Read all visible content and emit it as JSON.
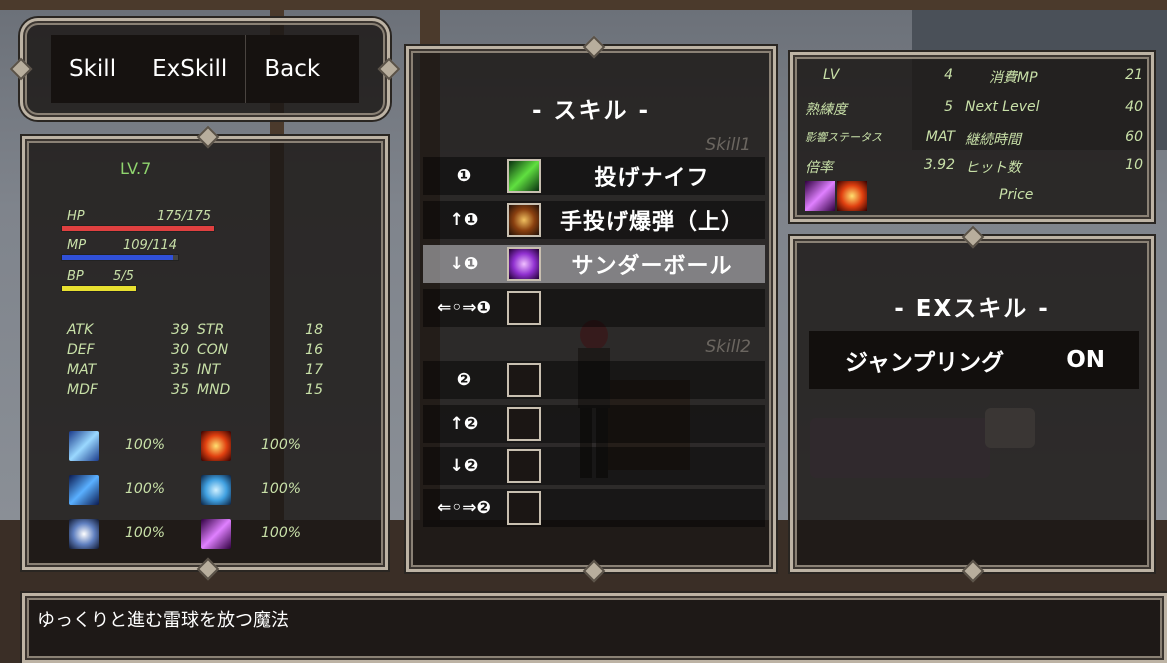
{
  "menu": {
    "items": [
      "Skill",
      "ExSkill",
      "Back"
    ]
  },
  "status": {
    "level": "LV.7",
    "hp": {
      "label": "HP",
      "value": "175/175",
      "fraction": 1.0,
      "color": "#e04040"
    },
    "mp": {
      "label": "MP",
      "value": "109/114",
      "fraction": 0.956,
      "color": "#3050d8"
    },
    "bp": {
      "label": "BP",
      "value": "5/5",
      "fraction": 1.0,
      "color": "#e8e030"
    },
    "stats_left": [
      {
        "label": "ATK",
        "value": "39"
      },
      {
        "label": "DEF",
        "value": "30"
      },
      {
        "label": "MAT",
        "value": "35"
      },
      {
        "label": "MDF",
        "value": "35"
      }
    ],
    "stats_right": [
      {
        "label": "STR",
        "value": "18"
      },
      {
        "label": "CON",
        "value": "16"
      },
      {
        "label": "INT",
        "value": "17"
      },
      {
        "label": "MND",
        "value": "15"
      }
    ],
    "resists": [
      {
        "icon": "ice-slash-icon",
        "value": "100%"
      },
      {
        "icon": "fire-orb-icon",
        "value": "100%"
      },
      {
        "icon": "water-slash-icon",
        "value": "100%"
      },
      {
        "icon": "ice-crystal-icon",
        "value": "100%"
      },
      {
        "icon": "light-burst-icon",
        "value": "100%"
      },
      {
        "icon": "dark-slash-icon",
        "value": "100%"
      }
    ]
  },
  "skills": {
    "title": "- スキル -",
    "group1": "Skill1",
    "group2": "Skill2",
    "rows": [
      {
        "key": "❶",
        "name": "投げナイフ",
        "icon": "green-knife-icon",
        "selected": false
      },
      {
        "key": "↑❶",
        "name": "手投げ爆弾（上）",
        "icon": "bomb-icon",
        "selected": false
      },
      {
        "key": "↓❶",
        "name": "サンダーボール",
        "icon": "purple-vortex-icon",
        "selected": true
      },
      {
        "key": "⇐◦⇒❶",
        "name": "",
        "icon": "",
        "selected": false
      },
      {
        "key": "❷",
        "name": "",
        "icon": "",
        "selected": false
      },
      {
        "key": "↑❷",
        "name": "",
        "icon": "",
        "selected": false
      },
      {
        "key": "↓❷",
        "name": "",
        "icon": "",
        "selected": false
      },
      {
        "key": "⇐◦⇒❷",
        "name": "",
        "icon": "",
        "selected": false
      }
    ]
  },
  "info": {
    "lv_label": "LV",
    "lv_value": "4",
    "mp_label": "消費MP",
    "mp_value": "21",
    "prof_label": "熟練度",
    "prof_value": "5",
    "next_label": "Next Level",
    "next_value": "40",
    "aff_label": "影響ステータス",
    "aff_value": "MAT",
    "dur_label": "継続時間",
    "dur_value": "60",
    "mult_label": "倍率",
    "mult_value": "3.92",
    "hits_label": "ヒット数",
    "hits_value": "10",
    "price_label": "Price"
  },
  "exskill": {
    "title": "- EXスキル -",
    "name": "ジャンプリング",
    "state": "ON"
  },
  "description": "ゆっくりと進む雷球を放つ魔法"
}
